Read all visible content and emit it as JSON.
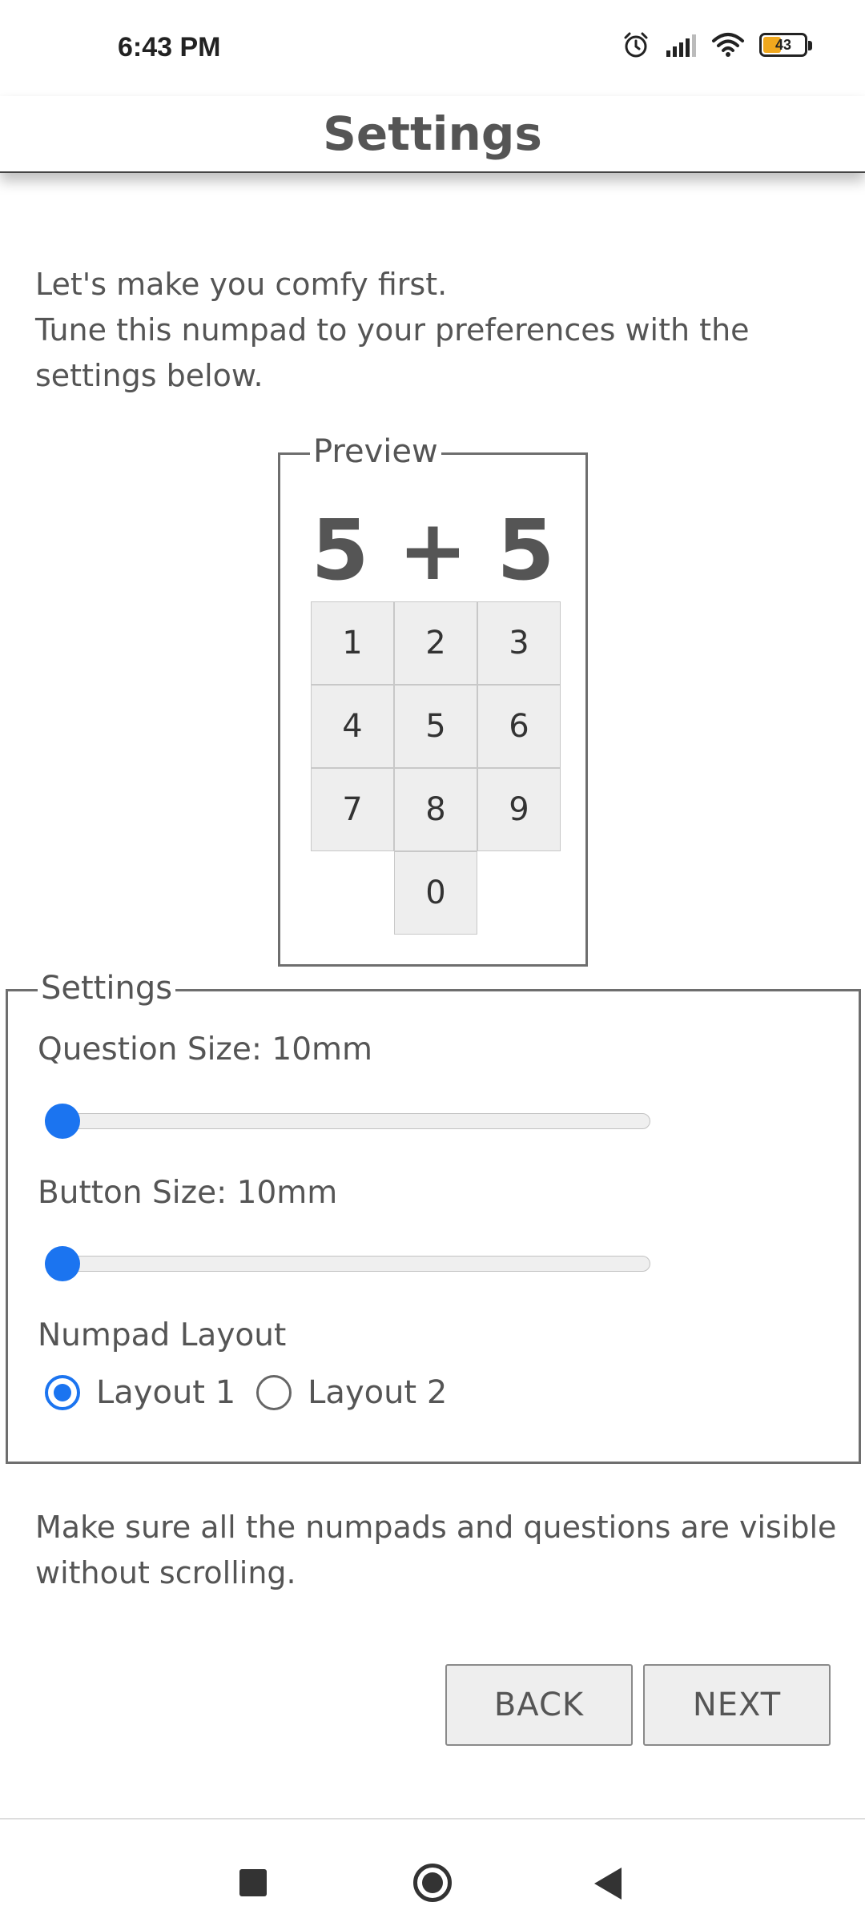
{
  "status_bar": {
    "time": "6:43 PM",
    "battery_level": "43",
    "icons": [
      "alarm-icon",
      "signal-icon",
      "wifi-icon",
      "battery-icon"
    ]
  },
  "header": {
    "title": "Settings"
  },
  "intro": {
    "line1": "Let's make you comfy first.",
    "line2": "Tune this numpad to your preferences with the",
    "line3": "settings below."
  },
  "preview": {
    "legend": "Preview",
    "question": "5 + 5",
    "keys": [
      "1",
      "2",
      "3",
      "4",
      "5",
      "6",
      "7",
      "8",
      "9",
      "0"
    ]
  },
  "settings": {
    "legend": "Settings",
    "question_size_label": "Question Size: 10mm",
    "question_size_value": 0,
    "button_size_label": "Button Size: 10mm",
    "button_size_value": 0,
    "layout_label": "Numpad Layout",
    "layout_options": [
      "Layout 1",
      "Layout 2"
    ],
    "layout_selected": "Layout 1"
  },
  "note": {
    "line1": "Make sure all the numpads and questions are visible",
    "line2": "without scrolling."
  },
  "buttons": {
    "back": "BACK",
    "next": "NEXT"
  },
  "colors": {
    "accent": "#1b74f0",
    "text": "#555555",
    "key_bg": "#eeeeee",
    "battery": "#f0a81e"
  },
  "nav_bar": {
    "icons": [
      "recents-square-icon",
      "home-circle-icon",
      "back-triangle-icon"
    ]
  }
}
